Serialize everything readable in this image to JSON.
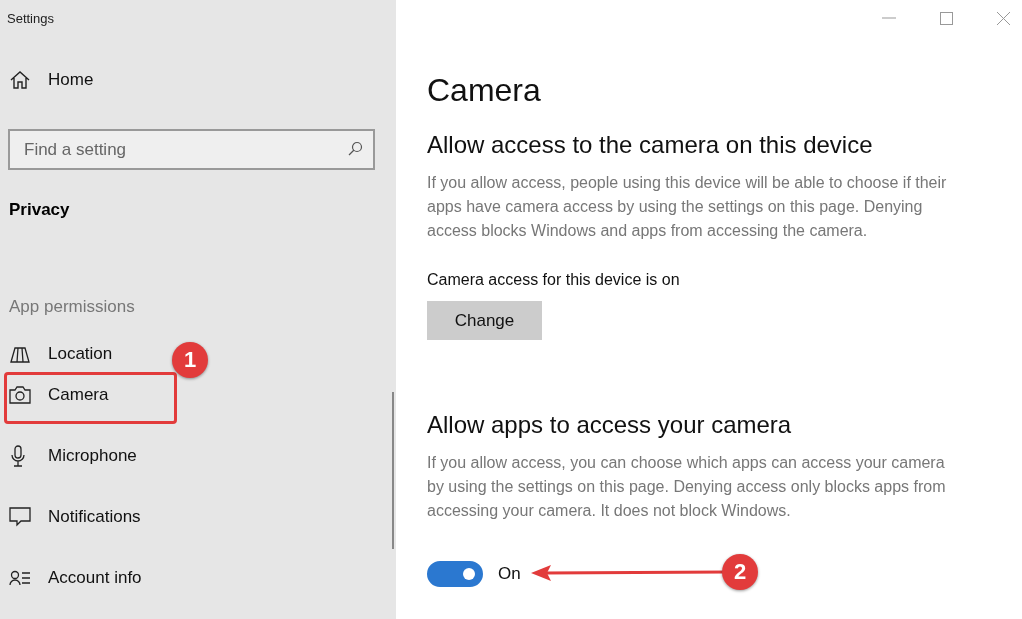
{
  "window": {
    "title": "Settings"
  },
  "sidebar": {
    "home": "Home",
    "search": {
      "placeholder": "Find a setting"
    },
    "section": "Privacy",
    "group": "App permissions",
    "items": [
      {
        "label": "Location",
        "kind": "location"
      },
      {
        "label": "Camera",
        "kind": "camera"
      },
      {
        "label": "Microphone",
        "kind": "microphone"
      },
      {
        "label": "Notifications",
        "kind": "notifications"
      },
      {
        "label": "Account info",
        "kind": "account"
      }
    ]
  },
  "content": {
    "title": "Camera",
    "sections": [
      {
        "kind": "button",
        "heading": "Allow access to the camera on this device",
        "text": "If you allow access, people using this device will be able to choose if their apps have camera access by using the settings on this page. Denying access blocks Windows and apps from accessing the camera.",
        "status": "Camera access for this device is on",
        "button": "Change"
      },
      {
        "kind": "toggle",
        "heading": "Allow apps to access your camera",
        "text": "If you allow access, you can choose which apps can access your camera by using the settings on this page. Denying access only blocks apps from accessing your camera. It does not block Windows.",
        "on": true,
        "state_label": "On"
      }
    ]
  },
  "annotations": [
    {
      "label": "1"
    },
    {
      "label": "2"
    }
  ]
}
